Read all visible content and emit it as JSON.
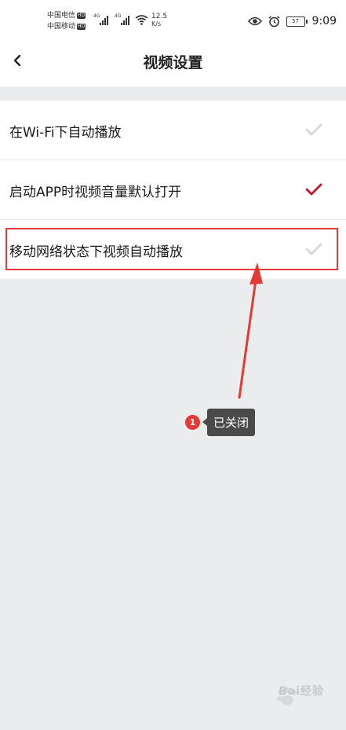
{
  "status_bar": {
    "carrier_1": "中国电信",
    "carrier_2": "中国移动",
    "hd_badge": "HD",
    "network_1": "4G",
    "network_2": "4G",
    "speed_value": "12.5",
    "speed_unit": "K/s",
    "battery": "57",
    "time": "9:09",
    "icons": [
      "eye-icon",
      "alarm-icon",
      "battery-icon",
      "wifi-icon",
      "signal-icon"
    ]
  },
  "header": {
    "title": "视频设置",
    "back_icon": "chevron-left-icon"
  },
  "settings": [
    {
      "label": "在Wi-Fi下自动播放",
      "checked": false
    },
    {
      "label": "启动APP时视频音量默认打开",
      "checked": true
    },
    {
      "label": "移动网络状态下视频自动播放",
      "checked": false
    }
  ],
  "annotation": {
    "number": "1",
    "label": "已关闭"
  },
  "watermark": {
    "text": "Bai经验",
    "icon": "baidu-paw-icon"
  },
  "colors": {
    "accent_check": "#c0182a",
    "unchecked": "#d4d4d4",
    "annotation_red": "#e53935",
    "background": "#ebecee"
  }
}
